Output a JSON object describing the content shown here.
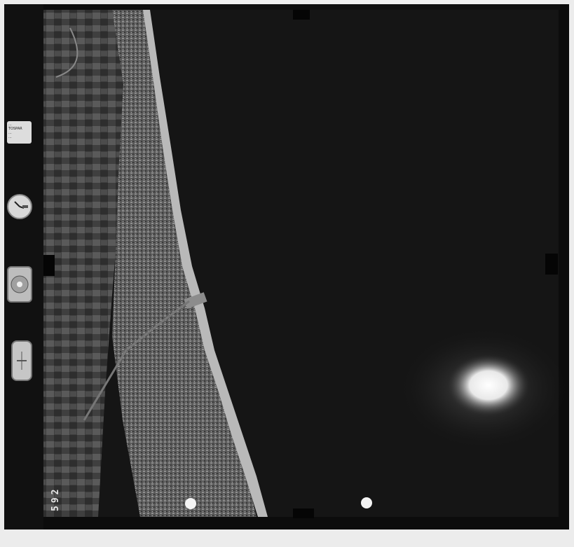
{
  "photo": {
    "frame_number": "592",
    "data_strip_label": [
      "...",
      "TOSPAR",
      "...",
      "..."
    ],
    "colors": {
      "sea": "#151515",
      "film": "#0c0c0c",
      "border": "#ececec",
      "beach": "#b9b9b9",
      "sun_glint": "#ffffff"
    },
    "icons": [
      "clock-icon",
      "level-bubble-icon",
      "altimeter-icon",
      "fiducial-mark-icon"
    ]
  }
}
